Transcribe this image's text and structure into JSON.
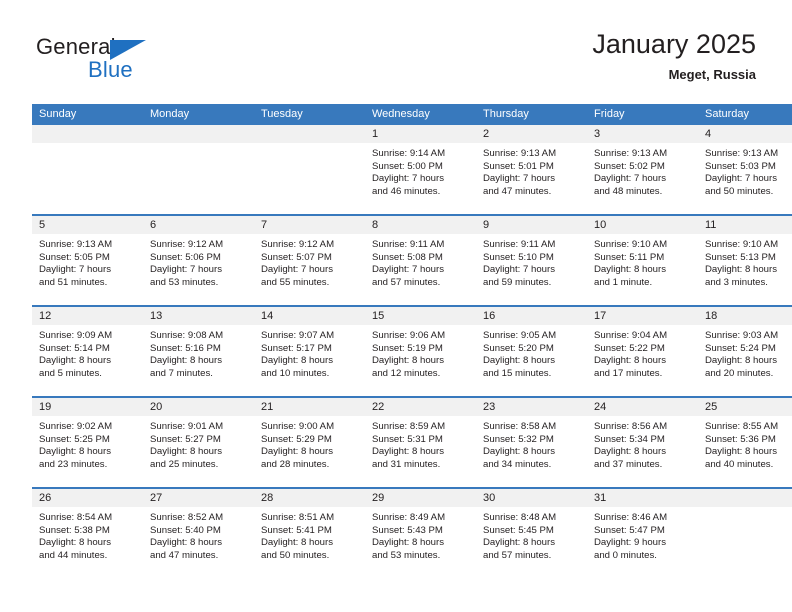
{
  "brand": {
    "name_part1": "General",
    "name_part2": "Blue",
    "logo_icon": "triangle-logo-icon"
  },
  "header": {
    "title": "January 2025",
    "subtitle": "Meget, Russia"
  },
  "calendar": {
    "weekday_headers": [
      "Sunday",
      "Monday",
      "Tuesday",
      "Wednesday",
      "Thursday",
      "Friday",
      "Saturday"
    ],
    "colors": {
      "header_blue": "#3879bd",
      "brand_blue": "#1f70c1",
      "daynum_band": "#f1f1f1",
      "text": "#231f20"
    },
    "weeks": [
      [
        {
          "day": "",
          "empty": true,
          "sunrise": "",
          "sunset": "",
          "daylight_line1": "",
          "daylight_line2": ""
        },
        {
          "day": "",
          "empty": true,
          "sunrise": "",
          "sunset": "",
          "daylight_line1": "",
          "daylight_line2": ""
        },
        {
          "day": "",
          "empty": true,
          "sunrise": "",
          "sunset": "",
          "daylight_line1": "",
          "daylight_line2": ""
        },
        {
          "day": "1",
          "sunrise": "Sunrise: 9:14 AM",
          "sunset": "Sunset: 5:00 PM",
          "daylight_line1": "Daylight: 7 hours",
          "daylight_line2": "and 46 minutes."
        },
        {
          "day": "2",
          "sunrise": "Sunrise: 9:13 AM",
          "sunset": "Sunset: 5:01 PM",
          "daylight_line1": "Daylight: 7 hours",
          "daylight_line2": "and 47 minutes."
        },
        {
          "day": "3",
          "sunrise": "Sunrise: 9:13 AM",
          "sunset": "Sunset: 5:02 PM",
          "daylight_line1": "Daylight: 7 hours",
          "daylight_line2": "and 48 minutes."
        },
        {
          "day": "4",
          "sunrise": "Sunrise: 9:13 AM",
          "sunset": "Sunset: 5:03 PM",
          "daylight_line1": "Daylight: 7 hours",
          "daylight_line2": "and 50 minutes."
        }
      ],
      [
        {
          "day": "5",
          "sunrise": "Sunrise: 9:13 AM",
          "sunset": "Sunset: 5:05 PM",
          "daylight_line1": "Daylight: 7 hours",
          "daylight_line2": "and 51 minutes."
        },
        {
          "day": "6",
          "sunrise": "Sunrise: 9:12 AM",
          "sunset": "Sunset: 5:06 PM",
          "daylight_line1": "Daylight: 7 hours",
          "daylight_line2": "and 53 minutes."
        },
        {
          "day": "7",
          "sunrise": "Sunrise: 9:12 AM",
          "sunset": "Sunset: 5:07 PM",
          "daylight_line1": "Daylight: 7 hours",
          "daylight_line2": "and 55 minutes."
        },
        {
          "day": "8",
          "sunrise": "Sunrise: 9:11 AM",
          "sunset": "Sunset: 5:08 PM",
          "daylight_line1": "Daylight: 7 hours",
          "daylight_line2": "and 57 minutes."
        },
        {
          "day": "9",
          "sunrise": "Sunrise: 9:11 AM",
          "sunset": "Sunset: 5:10 PM",
          "daylight_line1": "Daylight: 7 hours",
          "daylight_line2": "and 59 minutes."
        },
        {
          "day": "10",
          "sunrise": "Sunrise: 9:10 AM",
          "sunset": "Sunset: 5:11 PM",
          "daylight_line1": "Daylight: 8 hours",
          "daylight_line2": "and 1 minute."
        },
        {
          "day": "11",
          "sunrise": "Sunrise: 9:10 AM",
          "sunset": "Sunset: 5:13 PM",
          "daylight_line1": "Daylight: 8 hours",
          "daylight_line2": "and 3 minutes."
        }
      ],
      [
        {
          "day": "12",
          "sunrise": "Sunrise: 9:09 AM",
          "sunset": "Sunset: 5:14 PM",
          "daylight_line1": "Daylight: 8 hours",
          "daylight_line2": "and 5 minutes."
        },
        {
          "day": "13",
          "sunrise": "Sunrise: 9:08 AM",
          "sunset": "Sunset: 5:16 PM",
          "daylight_line1": "Daylight: 8 hours",
          "daylight_line2": "and 7 minutes."
        },
        {
          "day": "14",
          "sunrise": "Sunrise: 9:07 AM",
          "sunset": "Sunset: 5:17 PM",
          "daylight_line1": "Daylight: 8 hours",
          "daylight_line2": "and 10 minutes."
        },
        {
          "day": "15",
          "sunrise": "Sunrise: 9:06 AM",
          "sunset": "Sunset: 5:19 PM",
          "daylight_line1": "Daylight: 8 hours",
          "daylight_line2": "and 12 minutes."
        },
        {
          "day": "16",
          "sunrise": "Sunrise: 9:05 AM",
          "sunset": "Sunset: 5:20 PM",
          "daylight_line1": "Daylight: 8 hours",
          "daylight_line2": "and 15 minutes."
        },
        {
          "day": "17",
          "sunrise": "Sunrise: 9:04 AM",
          "sunset": "Sunset: 5:22 PM",
          "daylight_line1": "Daylight: 8 hours",
          "daylight_line2": "and 17 minutes."
        },
        {
          "day": "18",
          "sunrise": "Sunrise: 9:03 AM",
          "sunset": "Sunset: 5:24 PM",
          "daylight_line1": "Daylight: 8 hours",
          "daylight_line2": "and 20 minutes."
        }
      ],
      [
        {
          "day": "19",
          "sunrise": "Sunrise: 9:02 AM",
          "sunset": "Sunset: 5:25 PM",
          "daylight_line1": "Daylight: 8 hours",
          "daylight_line2": "and 23 minutes."
        },
        {
          "day": "20",
          "sunrise": "Sunrise: 9:01 AM",
          "sunset": "Sunset: 5:27 PM",
          "daylight_line1": "Daylight: 8 hours",
          "daylight_line2": "and 25 minutes."
        },
        {
          "day": "21",
          "sunrise": "Sunrise: 9:00 AM",
          "sunset": "Sunset: 5:29 PM",
          "daylight_line1": "Daylight: 8 hours",
          "daylight_line2": "and 28 minutes."
        },
        {
          "day": "22",
          "sunrise": "Sunrise: 8:59 AM",
          "sunset": "Sunset: 5:31 PM",
          "daylight_line1": "Daylight: 8 hours",
          "daylight_line2": "and 31 minutes."
        },
        {
          "day": "23",
          "sunrise": "Sunrise: 8:58 AM",
          "sunset": "Sunset: 5:32 PM",
          "daylight_line1": "Daylight: 8 hours",
          "daylight_line2": "and 34 minutes."
        },
        {
          "day": "24",
          "sunrise": "Sunrise: 8:56 AM",
          "sunset": "Sunset: 5:34 PM",
          "daylight_line1": "Daylight: 8 hours",
          "daylight_line2": "and 37 minutes."
        },
        {
          "day": "25",
          "sunrise": "Sunrise: 8:55 AM",
          "sunset": "Sunset: 5:36 PM",
          "daylight_line1": "Daylight: 8 hours",
          "daylight_line2": "and 40 minutes."
        }
      ],
      [
        {
          "day": "26",
          "sunrise": "Sunrise: 8:54 AM",
          "sunset": "Sunset: 5:38 PM",
          "daylight_line1": "Daylight: 8 hours",
          "daylight_line2": "and 44 minutes."
        },
        {
          "day": "27",
          "sunrise": "Sunrise: 8:52 AM",
          "sunset": "Sunset: 5:40 PM",
          "daylight_line1": "Daylight: 8 hours",
          "daylight_line2": "and 47 minutes."
        },
        {
          "day": "28",
          "sunrise": "Sunrise: 8:51 AM",
          "sunset": "Sunset: 5:41 PM",
          "daylight_line1": "Daylight: 8 hours",
          "daylight_line2": "and 50 minutes."
        },
        {
          "day": "29",
          "sunrise": "Sunrise: 8:49 AM",
          "sunset": "Sunset: 5:43 PM",
          "daylight_line1": "Daylight: 8 hours",
          "daylight_line2": "and 53 minutes."
        },
        {
          "day": "30",
          "sunrise": "Sunrise: 8:48 AM",
          "sunset": "Sunset: 5:45 PM",
          "daylight_line1": "Daylight: 8 hours",
          "daylight_line2": "and 57 minutes."
        },
        {
          "day": "31",
          "sunrise": "Sunrise: 8:46 AM",
          "sunset": "Sunset: 5:47 PM",
          "daylight_line1": "Daylight: 9 hours",
          "daylight_line2": "and 0 minutes."
        },
        {
          "day": "",
          "empty": true,
          "sunrise": "",
          "sunset": "",
          "daylight_line1": "",
          "daylight_line2": ""
        }
      ]
    ]
  }
}
